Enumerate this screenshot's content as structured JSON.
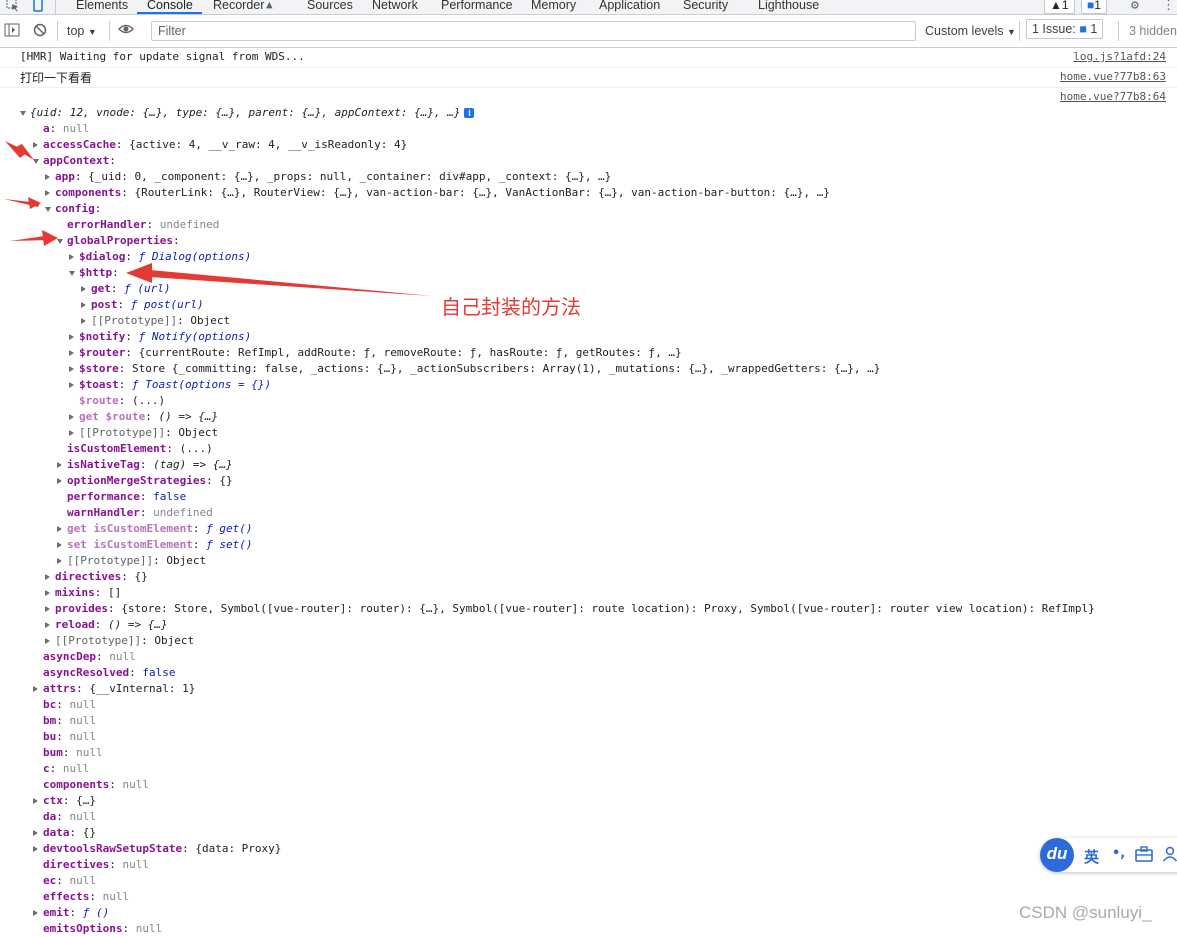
{
  "tabs": [
    "Elements",
    "Console",
    "Recorder",
    "Sources",
    "Network",
    "Performance",
    "Memory",
    "Application",
    "Security",
    "Lighthouse"
  ],
  "tab_badges": {
    "warnings": "1",
    "messages": "1"
  },
  "toolbar": {
    "context": "top",
    "filter_placeholder": "Filter",
    "levels": "Custom levels",
    "issues_label": "1 Issue:",
    "issues_count": "1",
    "hidden": "3 hidden"
  },
  "messages": [
    {
      "text": "[HMR] Waiting for update signal from WDS...",
      "source": "log.js?1afd:24"
    },
    {
      "text": "打印一下看看",
      "source": "home.vue?77b8:63"
    },
    {
      "text": "",
      "source": "home.vue?77b8:64"
    }
  ],
  "tree": [
    {
      "d": 0,
      "t": "e",
      "k": "",
      "v": "{uid: 12, vnode: {…}, type: {…}, parent: {…}, appContext: {…}, …}",
      "info": true
    },
    {
      "d": 1,
      "k": "a",
      "v": "null",
      "c": "nul"
    },
    {
      "d": 1,
      "t": "c",
      "k": "accessCache",
      "v": "{active: 4, __v_raw: 4, __v_isReadonly: 4}"
    },
    {
      "d": 1,
      "t": "e",
      "k": "appContext",
      "v": ""
    },
    {
      "d": 2,
      "t": "c",
      "k": "app",
      "v": "{_uid: 0, _component: {…}, _props: null, _container: div#app, _context: {…}, …}"
    },
    {
      "d": 2,
      "t": "c",
      "k": "components",
      "v": "{RouterLink: {…}, RouterView: {…}, van-action-bar: {…}, VanActionBar: {…}, van-action-bar-button: {…}, …}"
    },
    {
      "d": 2,
      "t": "e",
      "k": "config",
      "v": ""
    },
    {
      "d": 3,
      "k": "errorHandler",
      "v": "undefined",
      "c": "nul"
    },
    {
      "d": 3,
      "t": "e",
      "k": "globalProperties",
      "v": ""
    },
    {
      "d": 4,
      "t": "c",
      "k": "$dialog",
      "v": "ƒ Dialog(options)",
      "c": "fn"
    },
    {
      "d": 4,
      "t": "e",
      "k": "$http",
      "v": ""
    },
    {
      "d": 5,
      "t": "c",
      "k": "get",
      "v": "ƒ (url)",
      "c": "fn"
    },
    {
      "d": 5,
      "t": "c",
      "k": "post",
      "v": "ƒ post(url)",
      "c": "fn"
    },
    {
      "d": 5,
      "t": "c",
      "k": "[[Prototype]]",
      "v": "Object",
      "plain": true
    },
    {
      "d": 4,
      "t": "c",
      "k": "$notify",
      "v": "ƒ Notify(options)",
      "c": "fn"
    },
    {
      "d": 4,
      "t": "c",
      "k": "$router",
      "v": "{currentRoute: RefImpl, addRoute: ƒ, removeRoute: ƒ, hasRoute: ƒ, getRoutes: ƒ, …}"
    },
    {
      "d": 4,
      "t": "c",
      "k": "$store",
      "v": "Store {_committing: false, _actions: {…}, _actionSubscribers: Array(1), _mutations: {…}, _wrappedGetters: {…}, …}"
    },
    {
      "d": 4,
      "t": "c",
      "k": "$toast",
      "v": "ƒ Toast(options = {})",
      "c": "fn"
    },
    {
      "d": 4,
      "k": "$route",
      "v": "(...)",
      "dimk": true
    },
    {
      "d": 4,
      "t": "c",
      "k": "get $route",
      "v": "() => {…}",
      "dimk": true,
      "c": "it"
    },
    {
      "d": 4,
      "t": "c",
      "k": "[[Prototype]]",
      "v": "Object",
      "plain": true
    },
    {
      "d": 3,
      "k": "isCustomElement",
      "v": "(...)"
    },
    {
      "d": 3,
      "t": "c",
      "k": "isNativeTag",
      "v": "(tag) => {…}",
      "c": "it"
    },
    {
      "d": 3,
      "t": "c",
      "k": "optionMergeStrategies",
      "v": "{}"
    },
    {
      "d": 3,
      "k": "performance",
      "v": "false",
      "c": "kw"
    },
    {
      "d": 3,
      "k": "warnHandler",
      "v": "undefined",
      "c": "nul"
    },
    {
      "d": 3,
      "t": "c",
      "k": "get isCustomElement",
      "v": "ƒ get()",
      "dimk": true,
      "c": "fn"
    },
    {
      "d": 3,
      "t": "c",
      "k": "set isCustomElement",
      "v": "ƒ set()",
      "dimk": true,
      "c": "fn"
    },
    {
      "d": 3,
      "t": "c",
      "k": "[[Prototype]]",
      "v": "Object",
      "plain": true
    },
    {
      "d": 2,
      "t": "c",
      "k": "directives",
      "v": "{}"
    },
    {
      "d": 2,
      "t": "c",
      "k": "mixins",
      "v": "[]"
    },
    {
      "d": 2,
      "t": "c",
      "k": "provides",
      "v": "{store: Store, Symbol([vue-router]: router): {…}, Symbol([vue-router]: route location): Proxy, Symbol([vue-router]: router view location): RefImpl}"
    },
    {
      "d": 2,
      "t": "c",
      "k": "reload",
      "v": "() => {…}",
      "c": "it"
    },
    {
      "d": 2,
      "t": "c",
      "k": "[[Prototype]]",
      "v": "Object",
      "plain": true
    },
    {
      "d": 1,
      "k": "asyncDep",
      "v": "null",
      "c": "nul"
    },
    {
      "d": 1,
      "k": "asyncResolved",
      "v": "false",
      "c": "kw"
    },
    {
      "d": 1,
      "t": "c",
      "k": "attrs",
      "v": "{__vInternal: 1}"
    },
    {
      "d": 1,
      "k": "bc",
      "v": "null",
      "c": "nul"
    },
    {
      "d": 1,
      "k": "bm",
      "v": "null",
      "c": "nul"
    },
    {
      "d": 1,
      "k": "bu",
      "v": "null",
      "c": "nul"
    },
    {
      "d": 1,
      "k": "bum",
      "v": "null",
      "c": "nul"
    },
    {
      "d": 1,
      "k": "c",
      "v": "null",
      "c": "nul"
    },
    {
      "d": 1,
      "k": "components",
      "v": "null",
      "c": "nul"
    },
    {
      "d": 1,
      "t": "c",
      "k": "ctx",
      "v": "{…}"
    },
    {
      "d": 1,
      "k": "da",
      "v": "null",
      "c": "nul"
    },
    {
      "d": 1,
      "t": "c",
      "k": "data",
      "v": "{}"
    },
    {
      "d": 1,
      "t": "c",
      "k": "devtoolsRawSetupState",
      "v": "{data: Proxy}"
    },
    {
      "d": 1,
      "k": "directives",
      "v": "null",
      "c": "nul"
    },
    {
      "d": 1,
      "k": "ec",
      "v": "null",
      "c": "nul"
    },
    {
      "d": 1,
      "k": "effects",
      "v": "null",
      "c": "nul"
    },
    {
      "d": 1,
      "t": "c",
      "k": "emit",
      "v": "ƒ ()",
      "c": "fn"
    },
    {
      "d": 1,
      "k": "emitsOptions",
      "v": "null",
      "c": "nul"
    }
  ],
  "annotation": "自己封装的方法",
  "watermark": "CSDN @sunluyi_",
  "ime": {
    "logo": "du",
    "mode": "英"
  },
  "colors": {
    "accent": "#1a73e8",
    "key": "#881391",
    "number": "#1c00cf",
    "null": "#80868b",
    "annotation_red": "#e53935"
  }
}
